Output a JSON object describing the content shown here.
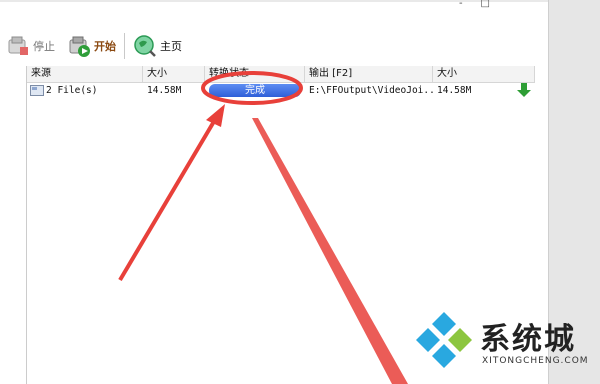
{
  "toolbar": {
    "stop_label": "停止",
    "start_label": "开始",
    "home_label": "主页"
  },
  "title_buttons": {
    "minimize": "-",
    "maximize": "□"
  },
  "table": {
    "headers": [
      "来源",
      "大小",
      "转换状态",
      "输出 [F2]",
      "大小"
    ],
    "rows": [
      {
        "source": "2 File(s)",
        "size": "14.58M",
        "status": "完成",
        "output": "E:\\FFOutput\\VideoJoi...",
        "out_size": "14.58M"
      }
    ]
  },
  "watermark": {
    "name": "系统城",
    "url": "XITONGCHENG.COM"
  },
  "colors": {
    "annotation_red": "#e8403a",
    "status_blue": "#3a68e0",
    "download_green": "#2e9e35"
  },
  "icons": [
    "stop-icon",
    "start-icon",
    "home-icon",
    "file-icon",
    "download-arrow-icon"
  ]
}
